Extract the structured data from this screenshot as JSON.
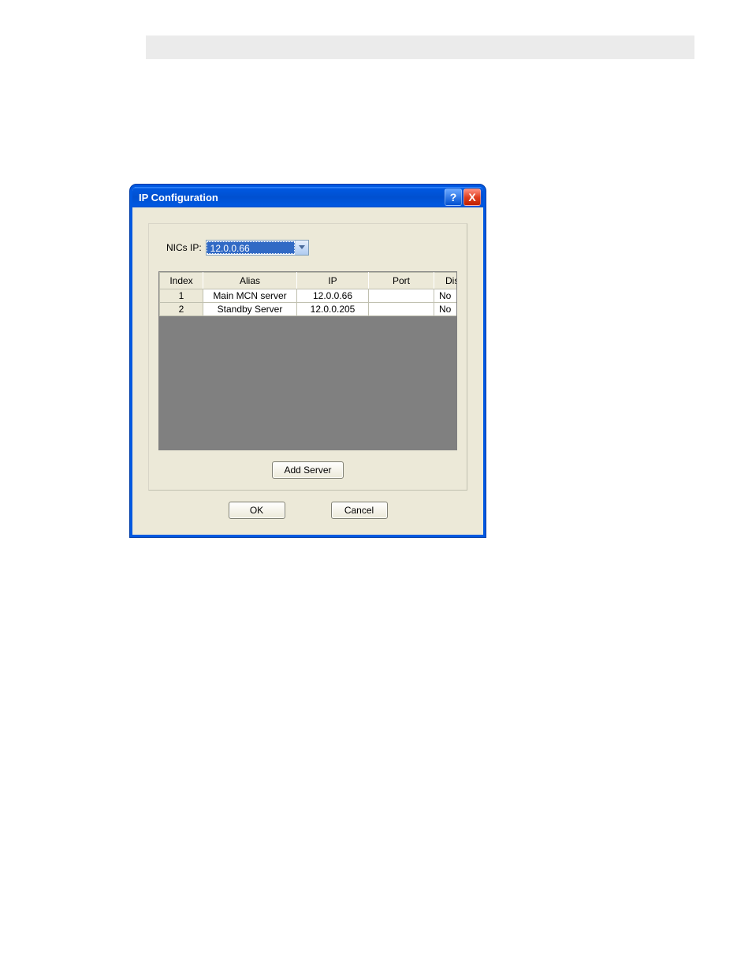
{
  "dialog": {
    "title": "IP Configuration",
    "help_glyph": "?",
    "close_glyph": "X"
  },
  "nics": {
    "label": "NICs IP:",
    "selected": "12.0.0.66"
  },
  "grid": {
    "headers": {
      "index": "Index",
      "alias": "Alias",
      "ip": "IP",
      "port": "Port",
      "disable": "Disable"
    },
    "rows": [
      {
        "index": "1",
        "alias": "Main MCN server",
        "ip": "12.0.0.66",
        "port": "",
        "disable": "No"
      },
      {
        "index": "2",
        "alias": "Standby Server",
        "ip": "12.0.0.205",
        "port": "",
        "disable": "No"
      }
    ]
  },
  "buttons": {
    "add_server": "Add Server",
    "ok": "OK",
    "cancel": "Cancel"
  }
}
